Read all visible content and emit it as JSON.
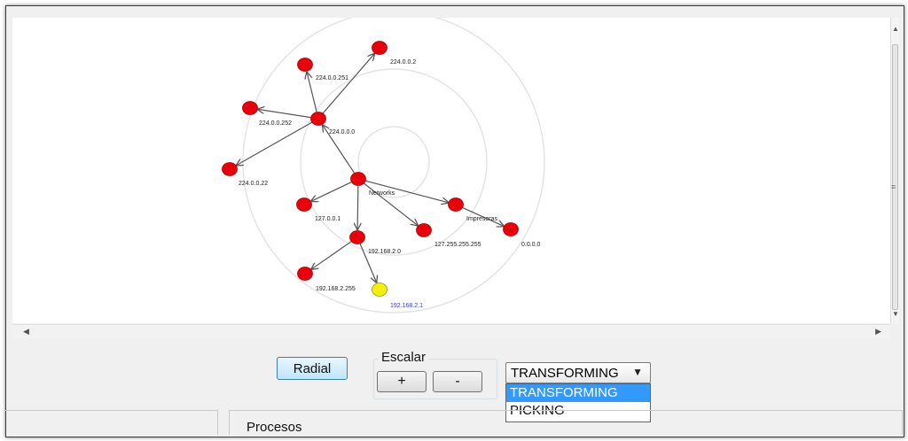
{
  "graph": {
    "nodes": [
      {
        "id": "n1",
        "label": "224.0.0.2",
        "color": "red"
      },
      {
        "id": "n2",
        "label": "224.0.0.251",
        "color": "red"
      },
      {
        "id": "n3",
        "label": "224.0.0.252",
        "color": "red"
      },
      {
        "id": "n4",
        "label": "224.0.0.0",
        "color": "red"
      },
      {
        "id": "n5",
        "label": "224.0.0.22",
        "color": "red"
      },
      {
        "id": "n6",
        "label": "Networks",
        "color": "red"
      },
      {
        "id": "n7",
        "label": "127.0.0.1",
        "color": "red"
      },
      {
        "id": "n8",
        "label": "Impresoras",
        "color": "red"
      },
      {
        "id": "n9",
        "label": "127.255.255.255",
        "color": "red"
      },
      {
        "id": "n10",
        "label": "0.0.0.0",
        "color": "red"
      },
      {
        "id": "n11",
        "label": "192.168.2.0",
        "color": "red"
      },
      {
        "id": "n12",
        "label": "192.168.2.255",
        "color": "red"
      },
      {
        "id": "n13",
        "label": "192.168.2.1",
        "color": "yellow"
      }
    ],
    "edges": [
      [
        "n6",
        "n4"
      ],
      [
        "n4",
        "n2"
      ],
      [
        "n4",
        "n1"
      ],
      [
        "n4",
        "n3"
      ],
      [
        "n4",
        "n5"
      ],
      [
        "n6",
        "n7"
      ],
      [
        "n6",
        "n8"
      ],
      [
        "n6",
        "n9"
      ],
      [
        "n6",
        "n11"
      ],
      [
        "n8",
        "n10"
      ],
      [
        "n11",
        "n12"
      ],
      [
        "n11",
        "n13"
      ]
    ],
    "colors": {
      "node": "#e8000b",
      "node_selected": "#f2ee0f",
      "edge": "#555555",
      "ring": "#e3e3e3",
      "label": "#222222",
      "label_selected": "#3b3bd6"
    }
  },
  "controls": {
    "radial_label": "Radial",
    "scale_label": "Escalar",
    "plus_label": "+",
    "minus_label": "-",
    "mode_selected": "TRANSFORMING",
    "mode_options": [
      "TRANSFORMING",
      "PICKING"
    ]
  },
  "bottom": {
    "procesos_label": "Procesos"
  }
}
